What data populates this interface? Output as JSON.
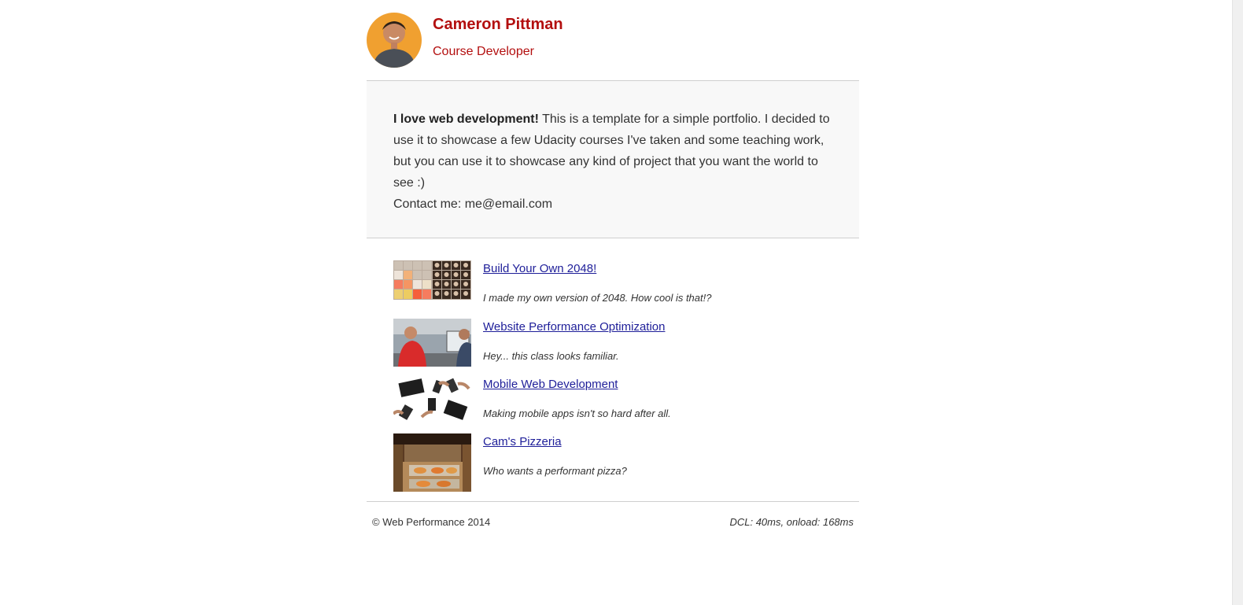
{
  "header": {
    "name": "Cameron Pittman",
    "role": "Course Developer",
    "avatar_icon": "person-portrait-icon"
  },
  "intro": {
    "lead": "I love web development!",
    "body": " This is a template for a simple portfolio. I decided to use it to showcase a few Udacity courses I've taken and some teaching work, but you can use it to showcase any kind of project that you want the world to see :)",
    "contact": "Contact me: me@email.com"
  },
  "projects": [
    {
      "title": "Build Your Own 2048!",
      "description": "I made my own version of 2048. How cool is that!?",
      "thumb_icon": "2048-game-thumbnail"
    },
    {
      "title": "Website Performance Optimization",
      "description": "Hey... this class looks familiar.",
      "thumb_icon": "classroom-video-thumbnail"
    },
    {
      "title": "Mobile Web Development",
      "description": "Making mobile apps isn't so hard after all.",
      "thumb_icon": "mobile-devices-thumbnail"
    },
    {
      "title": "Cam's Pizzeria",
      "description": "Who wants a performant pizza?",
      "thumb_icon": "pizzeria-thumbnail"
    }
  ],
  "footer": {
    "copyright": "© Web Performance 2014",
    "perf": "DCL: 40ms, onload: 168ms"
  },
  "colors": {
    "accent": "#b30f0f",
    "link": "#1e1e99",
    "intro_bg": "#f8f8f8"
  }
}
